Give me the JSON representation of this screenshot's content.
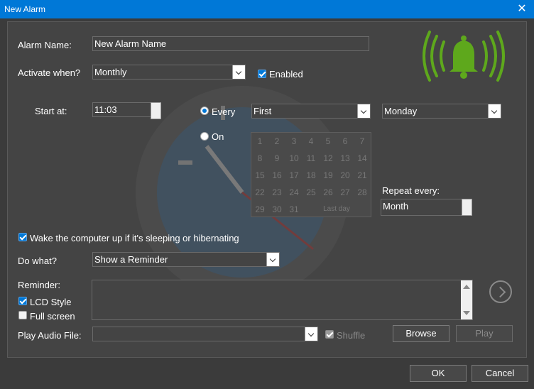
{
  "window": {
    "title": "New Alarm",
    "close_glyph": "✕"
  },
  "colors": {
    "titlebar": "#0078d7",
    "bell": "#5ea81c",
    "accent": "#0078d7"
  },
  "form": {
    "alarm_name_label": "Alarm Name:",
    "alarm_name_value": "New Alarm Name",
    "activate_label": "Activate when?",
    "activate_value": "Monthly",
    "enabled_label": "Enabled",
    "start_label": "Start at:",
    "start_time": "11:03",
    "every_label": "Every",
    "on_label": "On",
    "every_ordinal": "First",
    "every_day": "Monday",
    "repeat_label": "Repeat every:",
    "repeat_value": "Month",
    "wake_label": "Wake the computer up if it's sleeping or hibernating",
    "do_what_label": "Do what?",
    "do_what_value": "Show a Reminder",
    "reminder_label": "Reminder:",
    "lcd_label": "LCD Style",
    "fullscreen_label": "Full screen",
    "audio_label": "Play Audio File:",
    "audio_value": "",
    "shuffle_label": "Shuffle",
    "browse_label": "Browse",
    "play_label": "Play"
  },
  "calendar": {
    "days": [
      "1",
      "2",
      "3",
      "4",
      "5",
      "6",
      "7",
      "8",
      "9",
      "10",
      "11",
      "12",
      "13",
      "14",
      "15",
      "16",
      "17",
      "18",
      "19",
      "20",
      "21",
      "22",
      "23",
      "24",
      "25",
      "26",
      "27",
      "28",
      "29",
      "30",
      "31"
    ],
    "last_day_label": "Last day"
  },
  "footer": {
    "ok_label": "OK",
    "cancel_label": "Cancel"
  },
  "icons": {
    "bell": "bell-alarm-icon",
    "next": "chevron-right-circle-icon"
  }
}
